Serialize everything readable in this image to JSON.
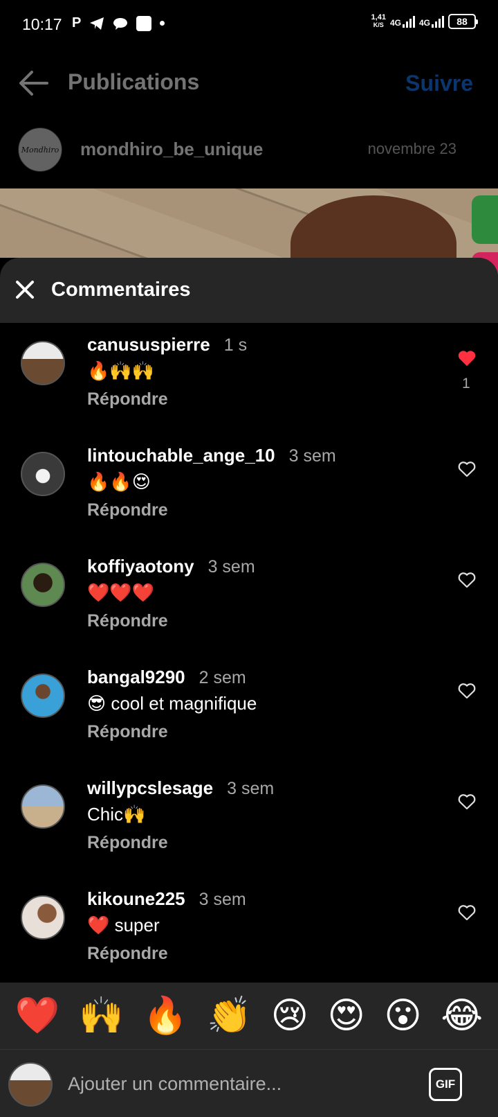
{
  "status_bar": {
    "time": "10:17",
    "speed_value": "1,41",
    "speed_unit": "K/S",
    "net1": "4G",
    "net2": "4G",
    "battery": "88"
  },
  "header": {
    "title": "Publications",
    "follow_label": "Suivre"
  },
  "post": {
    "username": "mondhiro_be_unique",
    "date": "novembre 23",
    "avatar_text": "Mondhiro"
  },
  "comments_sheet": {
    "title": "Commentaires",
    "reply_label": "Répondre",
    "items": [
      {
        "user": "canususpierre",
        "time": "1 s",
        "text": "🔥🙌🙌",
        "liked": true,
        "likes": "1"
      },
      {
        "user": "lintouchable_ange_10",
        "time": "3 sem",
        "text": "🔥🔥😍",
        "liked": false,
        "likes": ""
      },
      {
        "user": "koffiyaotony",
        "time": "3 sem",
        "text": "❤️❤️❤️",
        "liked": false,
        "likes": ""
      },
      {
        "user": "bangal9290",
        "time": "2 sem",
        "text": "😎 cool et magnifique",
        "liked": false,
        "likes": ""
      },
      {
        "user": "willypcslesage",
        "time": "3 sem",
        "text": "Chic🙌",
        "liked": false,
        "likes": ""
      },
      {
        "user": "kikoune225",
        "time": "3 sem",
        "text": "❤️ super",
        "liked": false,
        "likes": ""
      }
    ]
  },
  "emoji_bar": [
    "❤️",
    "🙌",
    "🔥",
    "👏",
    "😢",
    "😍",
    "😮",
    "😂"
  ],
  "comment_input": {
    "placeholder": "Ajouter un commentaire...",
    "gif_label": "GIF"
  },
  "colors": {
    "accent": "#1a77f2",
    "like_red": "#ff3040",
    "sheet_bg": "#262626"
  }
}
